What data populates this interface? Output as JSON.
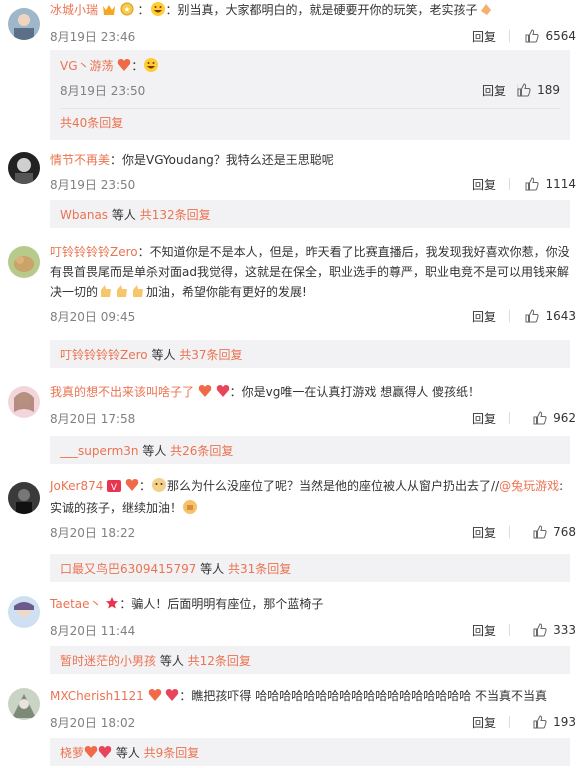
{
  "comments": [
    {
      "user": "冰城小瑞",
      "text": "：别当真，大家都明白的，就是硬要开你的玩笑，老实孩子",
      "time": "8月19日 23:46",
      "reply_label": "回复",
      "likes": "6564",
      "sub_reply": {
        "user": "VG丶游荡",
        "text": "：",
        "time": "8月19日 23:50",
        "reply_label": "回复",
        "likes": "189"
      },
      "more": "共40条回复"
    },
    {
      "user": "情节不再美",
      "text": "：你是VGYoudang？我特么还是王思聪呢",
      "time": "8月19日 23:50",
      "reply_label": "回复",
      "likes": "1114",
      "more_user": "Wbanas",
      "more_mid": " 等人 ",
      "more": "共132条回复"
    },
    {
      "user": "叮铃铃铃铃Zero",
      "text": "：不知道你是不是本人，但是，昨天看了比赛直播后，我发现我好喜欢你惹，你没有畏首畏尾而是单杀对面ad我觉得，这就是在保全，职业选手的尊严，职业电竞不是可以用钱来解决一切的",
      "text_tail": "加油，希望你能有更好的发展!",
      "time": "8月20日 09:45",
      "reply_label": "回复",
      "likes": "1643",
      "more_user": "叮铃铃铃铃Zero",
      "more_mid": " 等人 ",
      "more": "共37条回复"
    },
    {
      "user": "我真的想不出来该叫啥子了",
      "text": "：你是vg唯一在认真打游戏 想赢得人 傻孩纸！",
      "time": "8月20日 17:58",
      "reply_label": "回复",
      "likes": "962",
      "more_user": "___superm3n",
      "more_mid": " 等人 ",
      "more": "共26条回复"
    },
    {
      "user": "JoKer874",
      "text": "那么为什么没座位了呢？当然是他的座位被人从窗户扔出去了//",
      "mention": "@兔玩游戏",
      "text_after": ":",
      "text_line2": "实诚的孩子，继续加油！",
      "time": "8月20日 18:22",
      "reply_label": "回复",
      "likes": "768",
      "more_user": "口最又鸟巴6309415797",
      "more_mid": " 等人 ",
      "more": "共31条回复"
    },
    {
      "user": "Taetae丶",
      "text": "：骗人！后面明明有座位，那个蓝椅子",
      "time": "8月20日 11:44",
      "reply_label": "回复",
      "likes": "333",
      "more_user": "暂时迷茫的小男孩",
      "more_mid": " 等人 ",
      "more": "共12条回复"
    },
    {
      "user": "MXCherish1121",
      "text": "：瞧把孩吓得 哈哈哈哈哈哈哈哈哈哈哈哈哈哈哈哈哈哈 不当真不当真",
      "time": "8月20日 18:02",
      "reply_label": "回复",
      "likes": "193",
      "more_user": "桡萝",
      "more_mid": " 等人 ",
      "more": "共9条回复"
    }
  ],
  "colors": {
    "link": "#eb7350",
    "text": "#333333",
    "meta": "#808080",
    "box_bg": "#f2f2f5"
  },
  "icons": {
    "like": "thumb-up-icon",
    "vip": "crown-icon",
    "emoji": "emoji-icon"
  }
}
